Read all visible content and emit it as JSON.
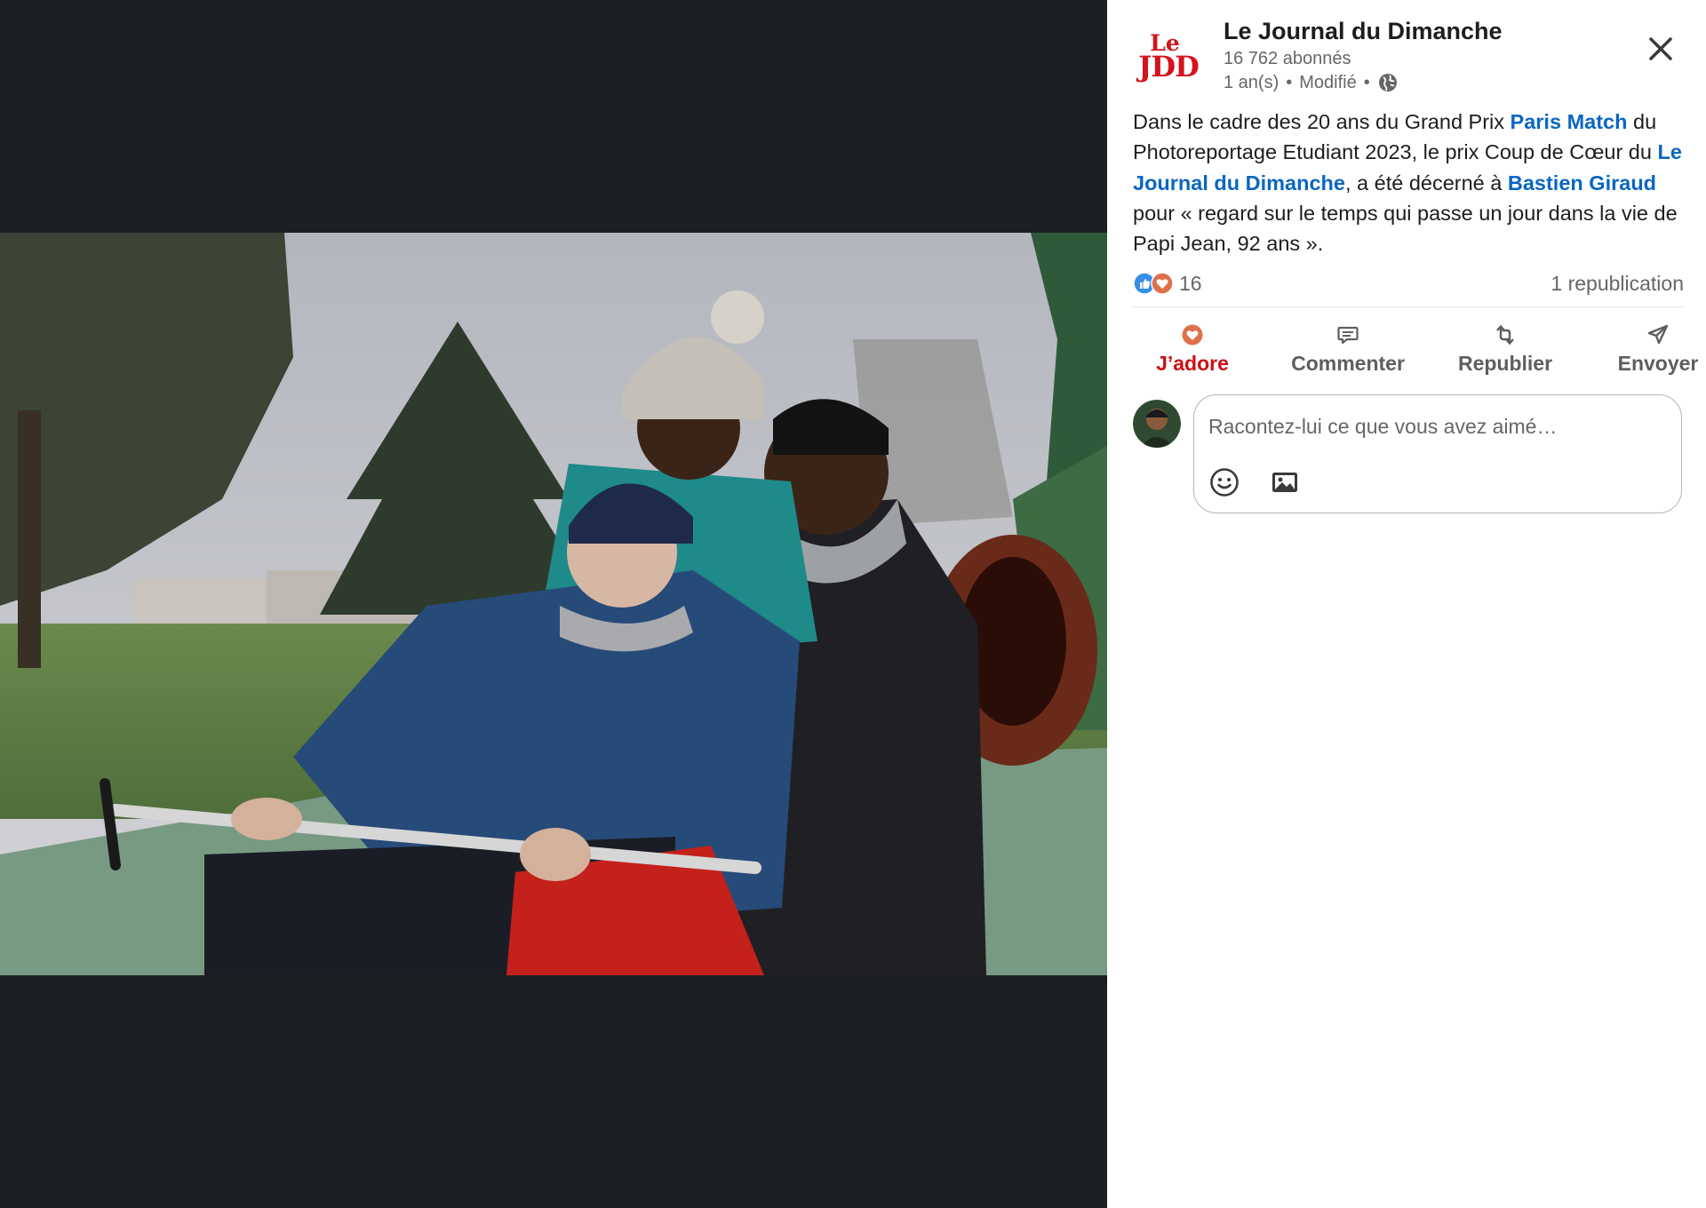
{
  "post": {
    "page_name": "Le Journal du Dimanche",
    "followers": "16 762 abonnés",
    "age": "1 an(s)",
    "separator": "•",
    "edited": "Modifié",
    "logo": {
      "line1": "Le",
      "line2": "JDD"
    },
    "text_parts": {
      "p1": "Dans le cadre des 20 ans du Grand Prix ",
      "link1": "Paris Match",
      "p2": " du Photoreportage Etudiant 2023, le prix Coup de Cœur du ",
      "link2": "Le Journal du Dimanche",
      "p3": ", a été décerné à ",
      "link3": "Bastien Giraud",
      "p4": " pour « regard sur le temps qui passe un jour dans la vie de Papi Jean, 92 ans »."
    },
    "reactions_count": "16",
    "reposts": "1 republication",
    "reaction_types": [
      "like",
      "love"
    ]
  },
  "actions": {
    "love": "J’adore",
    "comment": "Commenter",
    "repost": "Republier",
    "send": "Envoyer"
  },
  "composer": {
    "placeholder": "Racontez-lui ce que vous avez aimé…"
  },
  "icons": {
    "close": "close-icon",
    "globe": "globe-icon",
    "emoji": "emoji-icon",
    "image": "image-icon",
    "heart": "heart-icon",
    "comment": "comment-icon",
    "repost": "repost-icon",
    "send": "send-icon"
  },
  "colors": {
    "link": "#0a66c2",
    "active_reaction": "#cc1016",
    "viewer_background": "#1b1f23",
    "jdd_red": "#d4141c"
  }
}
